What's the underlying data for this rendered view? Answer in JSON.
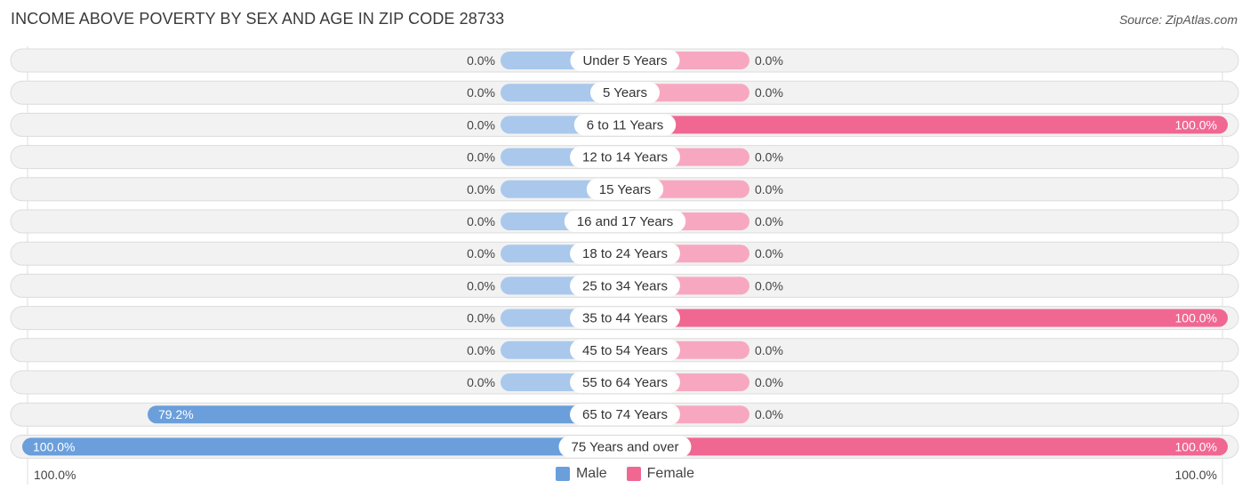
{
  "header": {
    "title": "INCOME ABOVE POVERTY BY SEX AND AGE IN ZIP CODE 28733",
    "source": "Source: ZipAtlas.com"
  },
  "colors": {
    "male": "#6a9fdb",
    "male_light": "#a9c8ec",
    "female": "#f06792",
    "female_light": "#f7a8c0",
    "row_bg": "#f2f2f2"
  },
  "legend": [
    {
      "label": "Male",
      "color": "#6a9fdb"
    },
    {
      "label": "Female",
      "color": "#f06792"
    }
  ],
  "axis": {
    "left_label": "100.0%",
    "right_label": "100.0%"
  },
  "chart_data": {
    "type": "bar",
    "title": "INCOME ABOVE POVERTY BY SEX AND AGE IN ZIP CODE 28733",
    "xlabel": "",
    "ylabel": "",
    "xlim": [
      -100,
      100
    ],
    "orientation": "horizontal-diverging",
    "legend_position": "bottom-center",
    "categories": [
      "Under 5 Years",
      "5 Years",
      "6 to 11 Years",
      "12 to 14 Years",
      "15 Years",
      "16 and 17 Years",
      "18 to 24 Years",
      "25 to 34 Years",
      "35 to 44 Years",
      "45 to 54 Years",
      "55 to 64 Years",
      "65 to 74 Years",
      "75 Years and over"
    ],
    "series": [
      {
        "name": "Male",
        "values": [
          0.0,
          0.0,
          0.0,
          0.0,
          0.0,
          0.0,
          0.0,
          0.0,
          0.0,
          0.0,
          0.0,
          79.2,
          100.0
        ],
        "labels": [
          "0.0%",
          "0.0%",
          "0.0%",
          "0.0%",
          "0.0%",
          "0.0%",
          "0.0%",
          "0.0%",
          "0.0%",
          "0.0%",
          "0.0%",
          "79.2%",
          "100.0%"
        ]
      },
      {
        "name": "Female",
        "values": [
          0.0,
          0.0,
          100.0,
          0.0,
          0.0,
          0.0,
          0.0,
          0.0,
          100.0,
          0.0,
          0.0,
          0.0,
          100.0
        ],
        "labels": [
          "0.0%",
          "0.0%",
          "100.0%",
          "0.0%",
          "0.0%",
          "0.0%",
          "0.0%",
          "0.0%",
          "100.0%",
          "0.0%",
          "0.0%",
          "0.0%",
          "100.0%"
        ]
      }
    ]
  }
}
